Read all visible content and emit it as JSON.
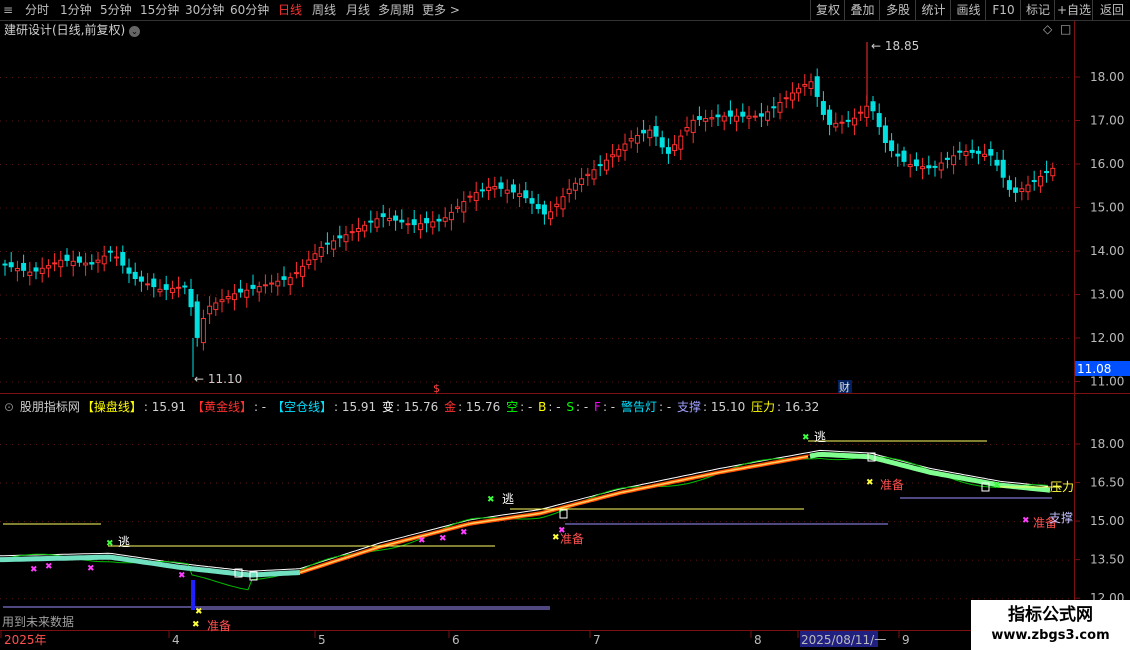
{
  "toolbar": {
    "timeframes": [
      "分时",
      "1分钟",
      "5分钟",
      "15分钟",
      "30分钟",
      "60分钟",
      "日线",
      "周线",
      "月线",
      "多周期",
      "更多 >"
    ],
    "active_index": 6,
    "buttons": [
      "复权",
      "叠加",
      "多股",
      "统计",
      "画线",
      "F10",
      "标记",
      "+自选",
      "返回"
    ]
  },
  "stock": {
    "title": "建研设计(日线,前复权)",
    "high_label": "18.85",
    "low_label": "11.10",
    "current_price": "11.08",
    "marker_s": "$",
    "marker_cai": "财"
  },
  "price_axis": [
    "18.00",
    "17.00",
    "16.00",
    "15.00",
    "14.00",
    "13.00",
    "12.00",
    "11.00"
  ],
  "indicator": {
    "name": "股朋指标网",
    "fields": [
      {
        "label": "【操盘线】",
        "value": ": 15.91",
        "color": "#ffff00"
      },
      {
        "label": "【黄金线】",
        "value": ": -",
        "color": "#ff3030"
      },
      {
        "label": "【空仓线】",
        "value": ": 15.91",
        "color": "#00e0ff"
      },
      {
        "label": "变",
        "value": ": 15.76",
        "color": "#ffffff"
      },
      {
        "label": "金",
        "value": ": 15.76",
        "color": "#ff3030"
      },
      {
        "label": "空",
        "value": ": -",
        "color": "#00ff00"
      },
      {
        "label": "B",
        "value": ": -",
        "color": "#ffff00"
      },
      {
        "label": "S",
        "value": ": -",
        "color": "#00ff00"
      },
      {
        "label": "F",
        "value": ": -",
        "color": "#ff00ff"
      },
      {
        "label": "警告灯",
        "value": ": -",
        "color": "#00e0ff"
      },
      {
        "label": "支撑",
        "value": ": 15.10",
        "color": "#a0a0ff"
      },
      {
        "label": "压力",
        "value": ": 16.32",
        "color": "#ffff00"
      }
    ],
    "axis": [
      "18.00",
      "16.50",
      "15.00",
      "13.50",
      "12.00"
    ],
    "labels": {
      "escape": "逃",
      "prepare": "准备",
      "pressure": "压力",
      "support": "支撑",
      "future_note": "用到未来数据"
    }
  },
  "date_axis": {
    "labels": [
      "2025年",
      "4",
      "5",
      "6",
      "7",
      "8",
      "2025/08/11/一",
      "9"
    ]
  },
  "watermark": {
    "line1": "指标公式网",
    "line2": "www.zbgs3.com"
  },
  "colors": {
    "up": "#ff3030",
    "down": "#00e0e0",
    "grid": "#7a1010"
  }
}
